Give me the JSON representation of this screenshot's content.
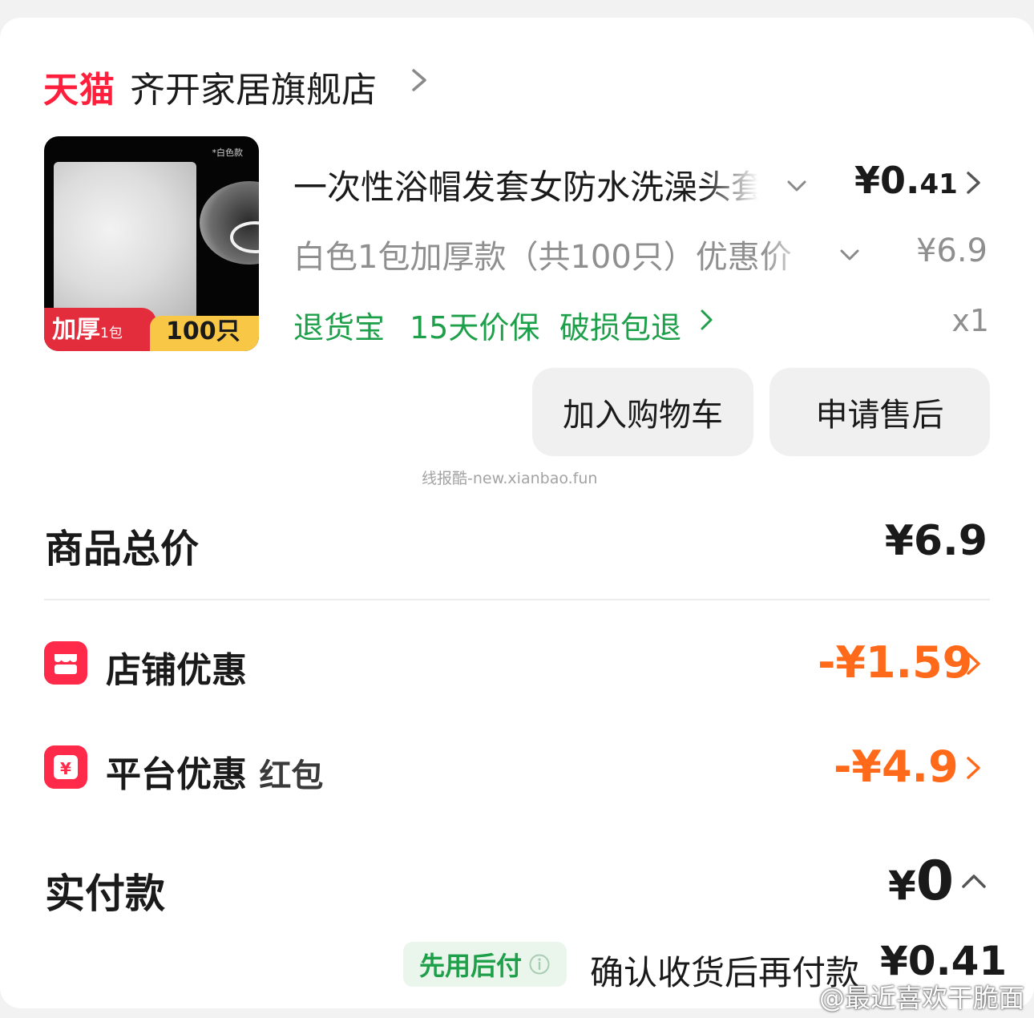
{
  "store": {
    "logo_text": "天猫",
    "name": "齐开家居旗舰店"
  },
  "product": {
    "image_tag": "*白色款",
    "image_band_left": "加厚",
    "image_band_left_small": "1包",
    "image_band_right": "100只",
    "title": "一次性浴帽发套女防水洗澡头套",
    "price_prefix": "¥0.",
    "price_cents": "41",
    "spec": "白色1包加厚款（共100只）优惠价",
    "original_price": "¥6.9",
    "tags": [
      "退货宝",
      "15天价保",
      "破损包退"
    ],
    "quantity": "x1"
  },
  "actions": {
    "add_to_cart": "加入购物车",
    "after_sales": "申请售后"
  },
  "watermark": "线报酷-new.xianbao.fun",
  "summary": {
    "total_label": "商品总价",
    "total_value": "¥6.9",
    "store_discount_label": "店铺优惠",
    "store_discount_value": "-¥1.59",
    "platform_discount_label": "平台优惠",
    "platform_discount_sub": "红包",
    "platform_discount_value": "-¥4.9",
    "pay_label": "实付款",
    "pay_currency": "¥",
    "pay_value": "0"
  },
  "pay_later": {
    "badge": "先用后付",
    "confirm_text": "确认收货后再付款",
    "confirm_amount": "¥0.41"
  },
  "weibo_watermark": "@最近喜欢干脆面",
  "colors": {
    "tmall_red": "#ff1f3c",
    "green": "#1ea04a",
    "discount_orange": "#ff6a1a",
    "icon_red": "#ff2a4a"
  },
  "icons": {
    "shop": "chevron-right-icon",
    "title_expand": "chevron-down-icon",
    "store_discount": "store-coupon-icon",
    "platform_discount": "red-packet-icon",
    "pay_collapse": "chevron-up-icon",
    "pay_later_info": "info-icon"
  }
}
